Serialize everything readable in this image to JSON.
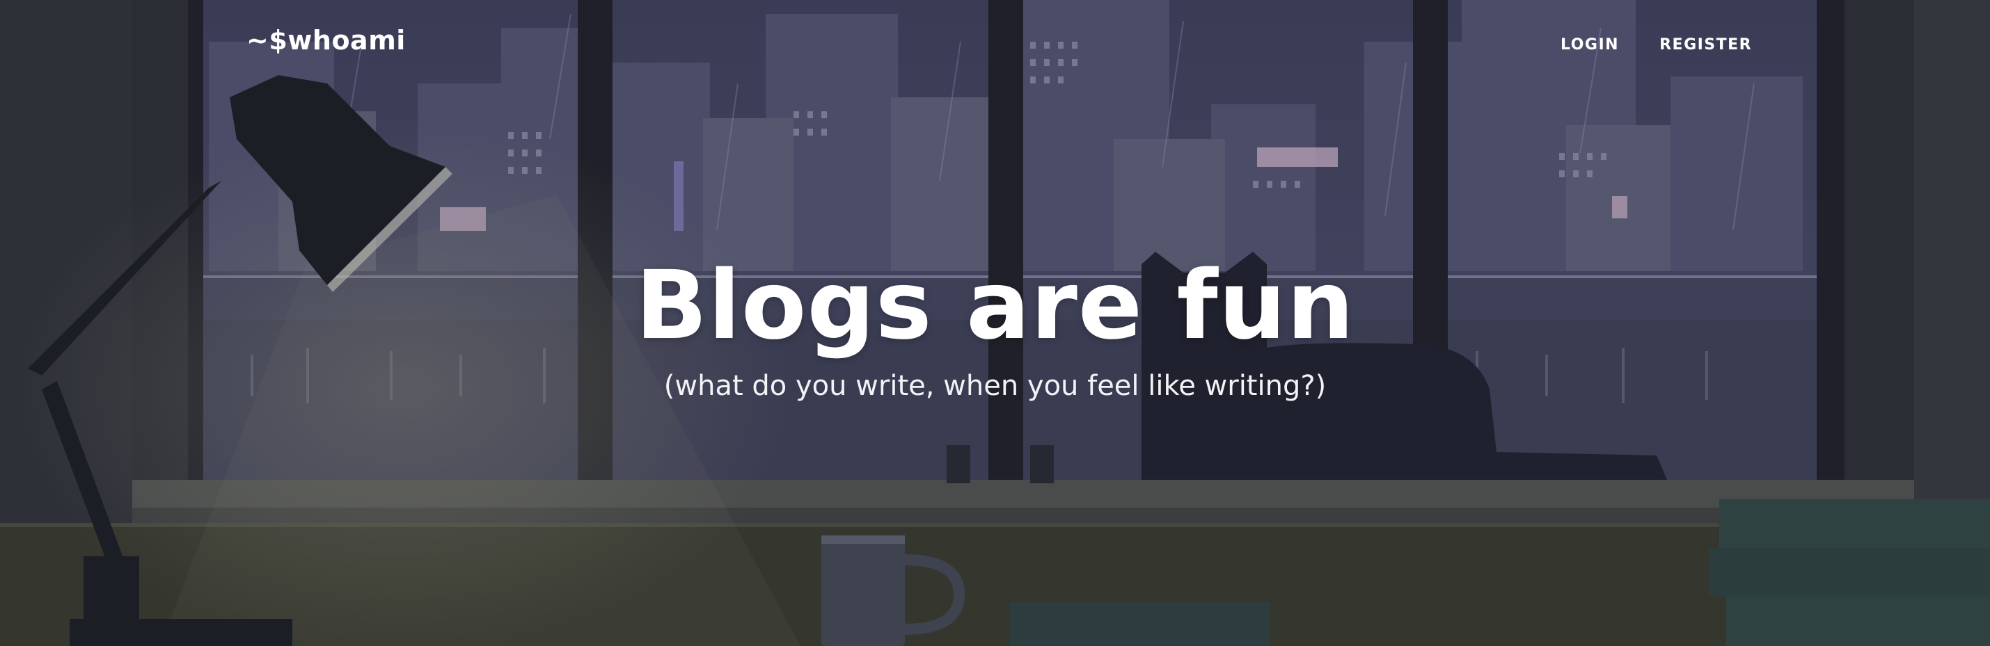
{
  "navbar": {
    "brand": "~$whoami",
    "links": [
      {
        "label": "LOGIN"
      },
      {
        "label": "REGISTER"
      }
    ]
  },
  "hero": {
    "title": "Blogs are fun",
    "subtitle": "(what do you write, when you feel like writing?)"
  },
  "colors": {
    "night_sky": "#3d3f58",
    "city_buildings": "#4a4c66",
    "window_frame": "#1e1f28",
    "desk": "#33352f",
    "lamp": "#1c1e26",
    "cat": "#20212e",
    "text": "#ffffff"
  }
}
